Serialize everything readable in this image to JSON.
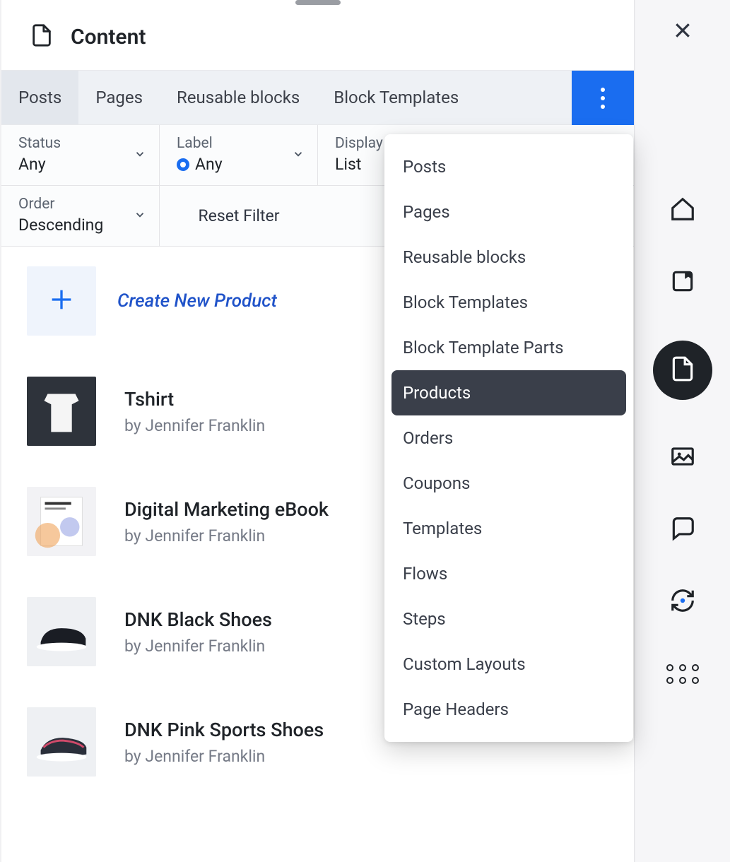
{
  "header": {
    "title": "Content"
  },
  "tabs": [
    {
      "label": "Posts",
      "active": true
    },
    {
      "label": "Pages",
      "active": false
    },
    {
      "label": "Reusable blocks",
      "active": false
    },
    {
      "label": "Block Templates",
      "active": false
    }
  ],
  "filters": {
    "status": {
      "label": "Status",
      "value": "Any"
    },
    "label_filter": {
      "label": "Label",
      "value": "Any"
    },
    "display": {
      "label": "Display",
      "value": "List"
    },
    "order": {
      "label": "Order",
      "value": "Descending"
    },
    "reset": "Reset Filter"
  },
  "create": {
    "label": "Create New Product"
  },
  "items": [
    {
      "title": "Tshirt",
      "author": "by Jennifer Franklin"
    },
    {
      "title": "Digital Marketing eBook",
      "author": "by Jennifer Franklin"
    },
    {
      "title": "DNK Black Shoes",
      "author": "by Jennifer Franklin"
    },
    {
      "title": "DNK Pink Sports Shoes",
      "author": "by Jennifer Franklin"
    }
  ],
  "popover": {
    "items": [
      "Posts",
      "Pages",
      "Reusable blocks",
      "Block Templates",
      "Block Template Parts",
      "Products",
      "Orders",
      "Coupons",
      "Templates",
      "Flows",
      "Steps",
      "Custom Layouts",
      "Page Headers"
    ],
    "active_index": 5
  },
  "sidebar_icons": [
    {
      "name": "home-icon"
    },
    {
      "name": "bookmark-icon"
    },
    {
      "name": "page-icon",
      "active": true
    },
    {
      "name": "image-icon"
    },
    {
      "name": "comment-icon"
    },
    {
      "name": "sync-icon"
    },
    {
      "name": "grid-icon"
    }
  ]
}
